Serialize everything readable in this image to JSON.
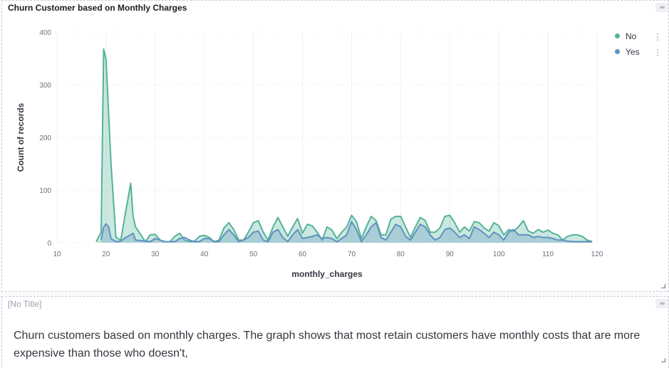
{
  "chart_panel": {
    "title": "Churn Customer based on Monthly Charges",
    "options_icon": "ellipsis-icon"
  },
  "text_panel": {
    "title": "[No Title]",
    "body": "Churn customers based on monthly charges. The graph shows that most retain customers have monthly costs that are more expensive than those who doesn't,",
    "options_icon": "ellipsis-icon"
  },
  "colors": {
    "no": "#54b399",
    "yes": "#6092c0",
    "grid": "#eef0f3",
    "axis_text": "#69707d"
  },
  "chart_data": {
    "type": "area",
    "xlabel": "monthly_charges",
    "ylabel": "Count of records",
    "xlim": [
      10,
      120
    ],
    "ylim": [
      0,
      400
    ],
    "x_ticks": [
      10,
      20,
      30,
      40,
      50,
      60,
      70,
      80,
      90,
      100,
      110,
      120
    ],
    "y_ticks": [
      0,
      100,
      200,
      300,
      400
    ],
    "grid": true,
    "legend_position": "top-right",
    "series": [
      {
        "name": "No",
        "x": [
          18,
          19,
          19.5,
          20,
          21,
          22,
          23,
          24,
          24.5,
          25,
          25.5,
          26,
          28,
          29,
          30,
          31,
          32,
          33,
          34,
          35,
          36,
          37,
          38,
          39,
          40,
          41,
          42,
          43,
          44,
          45,
          46,
          47,
          48,
          49,
          50,
          51,
          52,
          53,
          54,
          55,
          56,
          57,
          58,
          59,
          60,
          61,
          62,
          63,
          64,
          65,
          66,
          67,
          68,
          69,
          70,
          71,
          72,
          73,
          74,
          75,
          76,
          77,
          78,
          79,
          80,
          81,
          82,
          83,
          84,
          85,
          86,
          87,
          88,
          89,
          90,
          91,
          92,
          93,
          94,
          95,
          96,
          97,
          98,
          99,
          100,
          101,
          102,
          103,
          104,
          105,
          106,
          107,
          108,
          109,
          110,
          111,
          112,
          113,
          114,
          115,
          116,
          117,
          118,
          119
        ],
        "values": [
          2,
          20,
          368,
          348,
          150,
          10,
          5,
          60,
          85,
          113,
          50,
          30,
          2,
          15,
          16,
          5,
          2,
          2,
          12,
          18,
          5,
          2,
          3,
          12,
          14,
          10,
          2,
          5,
          28,
          38,
          25,
          5,
          5,
          20,
          38,
          42,
          20,
          5,
          30,
          48,
          30,
          12,
          30,
          46,
          18,
          35,
          32,
          20,
          5,
          30,
          24,
          8,
          20,
          30,
          52,
          40,
          8,
          30,
          50,
          42,
          15,
          15,
          45,
          50,
          50,
          30,
          10,
          30,
          48,
          42,
          20,
          20,
          28,
          50,
          52,
          38,
          20,
          30,
          22,
          40,
          38,
          28,
          22,
          38,
          32,
          15,
          25,
          22,
          30,
          42,
          22,
          18,
          25,
          20,
          24,
          18,
          15,
          5,
          12,
          15,
          15,
          12,
          5,
          2
        ]
      },
      {
        "name": "Yes",
        "x": [
          19,
          19.5,
          20,
          20.5,
          21,
          22,
          23,
          24,
          25,
          25.5,
          26,
          29,
          30,
          31,
          32,
          33,
          34,
          35,
          36,
          37,
          38,
          39,
          40,
          41,
          42,
          43,
          44,
          45,
          46,
          47,
          48,
          49,
          50,
          51,
          52,
          53,
          54,
          55,
          56,
          57,
          58,
          59,
          60,
          61,
          62,
          63,
          64,
          65,
          66,
          67,
          68,
          69,
          70,
          71,
          72,
          73,
          74,
          75,
          76,
          77,
          78,
          79,
          80,
          81,
          82,
          83,
          84,
          85,
          86,
          87,
          88,
          89,
          90,
          91,
          92,
          93,
          94,
          95,
          96,
          97,
          98,
          99,
          100,
          101,
          102,
          103,
          104,
          105,
          106,
          107,
          108,
          109,
          110,
          111,
          112,
          113,
          114,
          115,
          116,
          117,
          118,
          119
        ],
        "values": [
          5,
          30,
          36,
          30,
          8,
          2,
          3,
          10,
          15,
          18,
          5,
          2,
          8,
          5,
          2,
          2,
          2,
          8,
          10,
          5,
          2,
          2,
          8,
          8,
          2,
          2,
          15,
          25,
          15,
          2,
          5,
          10,
          20,
          22,
          5,
          2,
          20,
          25,
          10,
          2,
          15,
          25,
          8,
          10,
          12,
          15,
          8,
          10,
          8,
          2,
          8,
          15,
          40,
          25,
          2,
          15,
          30,
          38,
          10,
          5,
          20,
          35,
          30,
          12,
          5,
          20,
          35,
          30,
          15,
          5,
          10,
          25,
          28,
          20,
          10,
          15,
          8,
          30,
          25,
          18,
          10,
          20,
          15,
          5,
          20,
          25,
          15,
          15,
          15,
          10,
          12,
          10,
          10,
          8,
          5,
          5,
          3,
          2,
          2,
          2,
          2,
          2
        ]
      }
    ]
  }
}
